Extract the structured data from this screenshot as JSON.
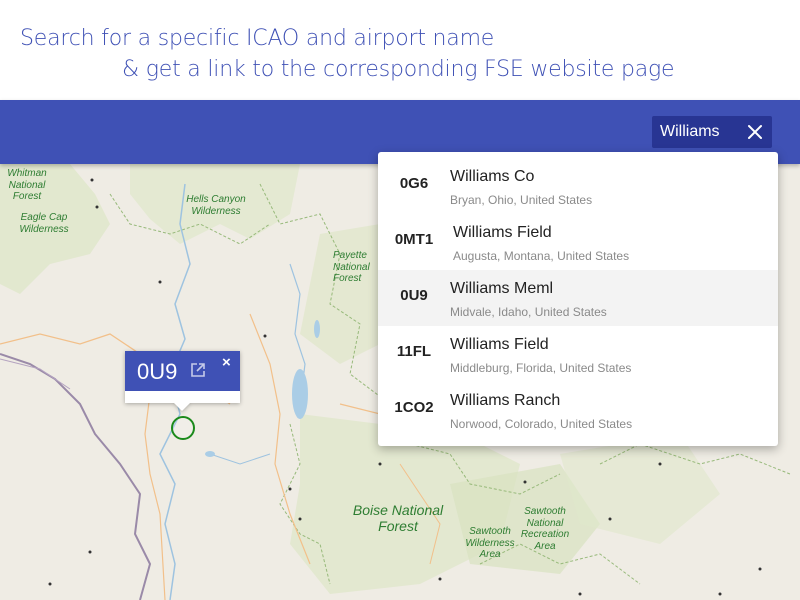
{
  "caption": {
    "line1": "Search for a specific ICAO and airport name",
    "line2": "& get a link to the corresponding FSE website page"
  },
  "search": {
    "value": "Williams",
    "clear_icon": "close-icon"
  },
  "results": [
    {
      "code": "0G6",
      "name": "Williams Co",
      "location": "Bryan, Ohio, United States"
    },
    {
      "code": "0MT1",
      "name": "Williams Field",
      "location": "Augusta, Montana, United States"
    },
    {
      "code": "0U9",
      "name": "Williams Meml",
      "location": "Midvale, Idaho, United States"
    },
    {
      "code": "11FL",
      "name": "Williams Field",
      "location": "Middleburg, Florida, United States"
    },
    {
      "code": "1CO2",
      "name": "Williams Ranch",
      "location": "Norwood, Colorado, United States"
    }
  ],
  "highlighted_result": "0U9",
  "popup": {
    "code": "0U9",
    "close_label": "×",
    "link_icon": "open-in-new-icon"
  },
  "map_labels": {
    "whitman": "Whitman National Forest",
    "eagle_cap": "Eagle Cap Wilderness",
    "hells_canyon": "Hells Canyon Wilderness",
    "payette": "Payette National Forest",
    "boise": "Boise National Forest",
    "sawtooth_wild": "Sawtooth Wilderness Area",
    "sawtooth_rec": "Sawtooth National Recreation Area"
  },
  "colors": {
    "primary": "#3f51b5",
    "search_bg": "#283593",
    "map_bg": "#efece4",
    "forest_text": "#2e7d32",
    "marker": "#1b8a1b"
  }
}
